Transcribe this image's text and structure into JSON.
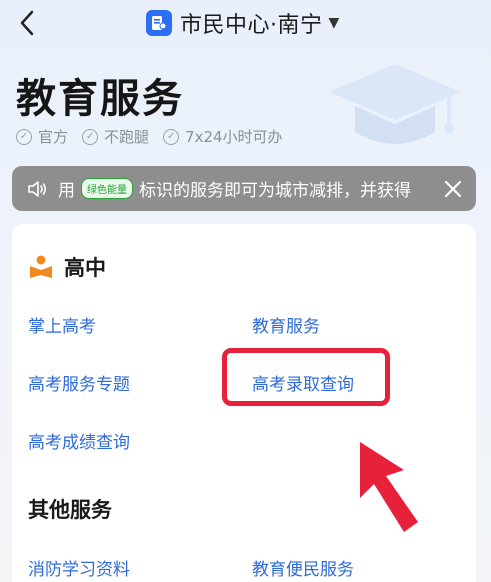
{
  "nav": {
    "back_icon": "chevron-left-icon",
    "app_icon": "citizen-center-icon",
    "title": "市民中心·南宁",
    "caret": "▼"
  },
  "page": {
    "title": "教育服务",
    "hero_icon": "graduation-cap-icon",
    "badges": [
      "官方",
      "不跑腿",
      "7x24小时可办"
    ]
  },
  "notice": {
    "prefix": "用",
    "tag": "绿色能量",
    "text": "标识的服务即可为城市减排，并获得",
    "speaker_icon": "speaker-icon",
    "close_icon": "close-icon"
  },
  "sections": {
    "high_school": {
      "label": "高中",
      "icon": "book-reader-icon",
      "links": [
        "掌上高考",
        "教育服务",
        "高考服务专题",
        "高考录取查询",
        "高考成绩查询"
      ]
    },
    "other": {
      "label": "其他服务",
      "links": [
        "消防学习资料",
        "教育便民服务"
      ]
    }
  },
  "annotation": {
    "highlight_color": "#e8213b"
  },
  "colors": {
    "link": "#2f6bd8",
    "accent_orange": "#f08a1c",
    "brand_blue": "#2b6ff3"
  }
}
